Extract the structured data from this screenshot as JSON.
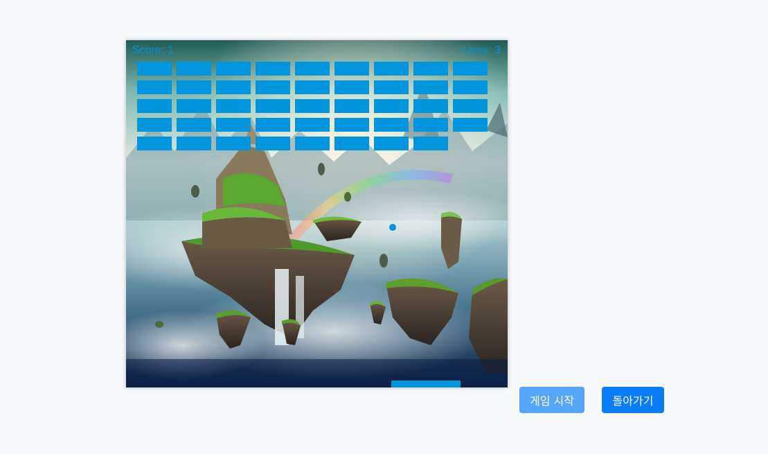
{
  "game": {
    "score_text": "Score: 1",
    "lives_text": "Lives: 3",
    "score": 1,
    "lives": 3,
    "accent_color": "#0095dd",
    "brick_rows": [
      {
        "count": 9
      },
      {
        "count": 9
      },
      {
        "count": 9
      },
      {
        "count": 9
      },
      {
        "count": 8
      }
    ],
    "background": "floating-islands-fantasy-landscape"
  },
  "buttons": {
    "start_label": "게임 시작",
    "back_label": "돌아가기",
    "start_color": "#55a6fa",
    "back_color": "#0a7cf5"
  }
}
